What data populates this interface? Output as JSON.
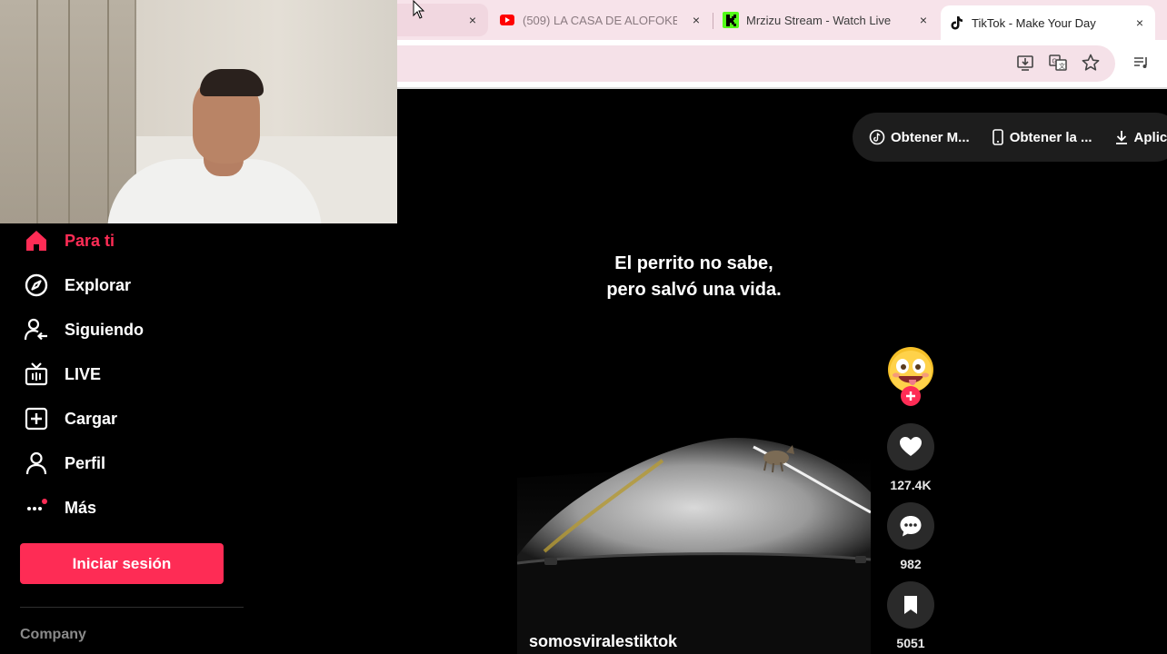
{
  "browser": {
    "tabs": [
      {
        "label": "",
        "close": "×"
      },
      {
        "label": "(509) LA CASA DE ALOFOKE",
        "close": "×",
        "favicon": "youtube-icon"
      },
      {
        "label": "Mrzizu Stream - Watch Live",
        "close": "×",
        "favicon": "kick-icon"
      },
      {
        "label": "TikTok - Make Your Day",
        "close": "×",
        "favicon": "tiktok-icon",
        "active": true
      }
    ]
  },
  "sidebar": {
    "items": [
      {
        "label": "Para ti",
        "icon": "home-icon",
        "active": true
      },
      {
        "label": "Explorar",
        "icon": "compass-icon"
      },
      {
        "label": "Siguiendo",
        "icon": "following-icon"
      },
      {
        "label": "LIVE",
        "icon": "live-icon"
      },
      {
        "label": "Cargar",
        "icon": "upload-icon"
      },
      {
        "label": "Perfil",
        "icon": "profile-icon"
      },
      {
        "label": "Más",
        "icon": "more-icon"
      }
    ],
    "login_label": "Iniciar sesión",
    "company_label": "Company"
  },
  "top_pill": {
    "items": [
      {
        "label": "Obtener M...",
        "icon": "tiktok-coin-icon"
      },
      {
        "label": "Obtener la ...",
        "icon": "phone-icon"
      },
      {
        "label": "Aplic",
        "icon": "download-icon"
      }
    ]
  },
  "video": {
    "caption_line1": "El perrito no sabe,",
    "caption_line2": "pero salvó una vida.",
    "author": "somosviralestiktok"
  },
  "actions": {
    "likes": "127.4K",
    "comments": "982",
    "saves": "5051"
  },
  "colors": {
    "accent": "#fe2c55",
    "chrome_bg": "#f7e3ea"
  }
}
